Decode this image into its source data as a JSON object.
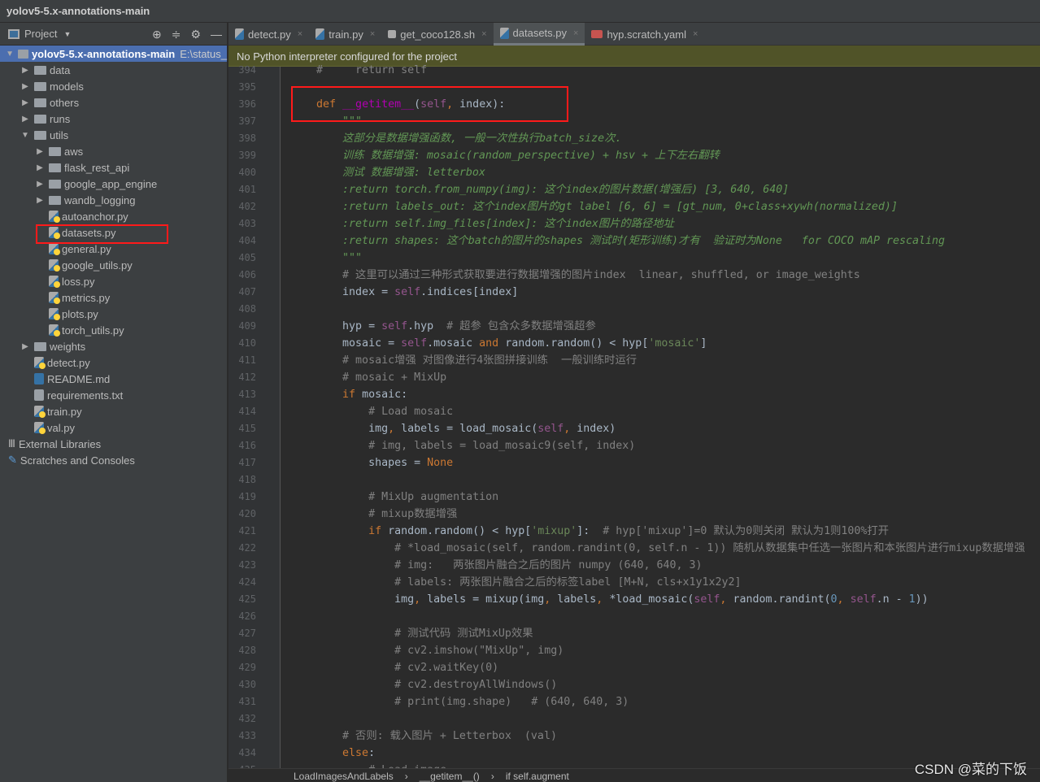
{
  "title": "yolov5-5.x-annotations-main",
  "sidebar": {
    "header": "Project",
    "header_chevron": "▼",
    "tools": [
      "⊕",
      "≑",
      "⚙",
      "—"
    ],
    "items": [
      {
        "label": "yolov5-5.x-annotations-main",
        "path": "E:\\status_",
        "type": "folder",
        "level": 0,
        "expanded": true,
        "selected": true
      },
      {
        "label": "data",
        "type": "folder",
        "level": 1
      },
      {
        "label": "models",
        "type": "folder",
        "level": 1
      },
      {
        "label": "others",
        "type": "folder",
        "level": 1
      },
      {
        "label": "runs",
        "type": "folder",
        "level": 1
      },
      {
        "label": "utils",
        "type": "folder",
        "level": 1,
        "expanded": true
      },
      {
        "label": "aws",
        "type": "folder",
        "level": 2
      },
      {
        "label": "flask_rest_api",
        "type": "folder",
        "level": 2
      },
      {
        "label": "google_app_engine",
        "type": "folder",
        "level": 2
      },
      {
        "label": "wandb_logging",
        "type": "folder",
        "level": 2
      },
      {
        "label": "autoanchor.py",
        "type": "py",
        "level": 2
      },
      {
        "label": "datasets.py",
        "type": "py",
        "level": 2,
        "highlighted": true
      },
      {
        "label": "general.py",
        "type": "py",
        "level": 2
      },
      {
        "label": "google_utils.py",
        "type": "py",
        "level": 2
      },
      {
        "label": "loss.py",
        "type": "py",
        "level": 2
      },
      {
        "label": "metrics.py",
        "type": "py",
        "level": 2
      },
      {
        "label": "plots.py",
        "type": "py",
        "level": 2
      },
      {
        "label": "torch_utils.py",
        "type": "py",
        "level": 2
      },
      {
        "label": "weights",
        "type": "folder",
        "level": 1
      },
      {
        "label": "detect.py",
        "type": "py",
        "level": 1
      },
      {
        "label": "README.md",
        "type": "md",
        "level": 1
      },
      {
        "label": "requirements.txt",
        "type": "txt",
        "level": 1
      },
      {
        "label": "train.py",
        "type": "py",
        "level": 1
      },
      {
        "label": "val.py",
        "type": "py",
        "level": 1
      },
      {
        "label": "External Libraries",
        "type": "lib",
        "level": 0
      },
      {
        "label": "Scratches and Consoles",
        "type": "scratch",
        "level": 0
      }
    ]
  },
  "tabs": [
    {
      "label": "detect.py",
      "icon": "python"
    },
    {
      "label": "train.py",
      "icon": "python"
    },
    {
      "label": "get_coco128.sh",
      "icon": "shell"
    },
    {
      "label": "datasets.py",
      "icon": "python",
      "active": true
    },
    {
      "label": "hyp.scratch.yaml",
      "icon": "yaml"
    }
  ],
  "tab_close": "×",
  "banner": "No Python interpreter configured for the project",
  "code": [
    {
      "n": "394",
      "t": [
        [
          "cm",
          "    #     return self"
        ]
      ]
    },
    {
      "n": "395",
      "t": []
    },
    {
      "n": "396",
      "t": [
        [
          "kw",
          "    def "
        ],
        [
          "fn",
          "__getitem__"
        ],
        [
          "plain",
          "("
        ],
        [
          "self",
          "self"
        ],
        [
          "kw",
          ", "
        ],
        [
          "plain",
          "index):"
        ]
      ]
    },
    {
      "n": "397",
      "t": [
        [
          "doc",
          "        \"\"\""
        ]
      ]
    },
    {
      "n": "398",
      "t": [
        [
          "doc",
          "        这部分是数据增强函数, 一般一次性执行batch_size次."
        ]
      ]
    },
    {
      "n": "399",
      "t": [
        [
          "doc",
          "        训练 数据增强: mosaic(random_perspective) + hsv + 上下左右翻转"
        ]
      ]
    },
    {
      "n": "400",
      "t": [
        [
          "doc",
          "        测试 数据增强: letterbox"
        ]
      ]
    },
    {
      "n": "401",
      "t": [
        [
          "doc",
          "        :return torch.from_numpy(img): 这个index的图片数据(增强后) [3, 640, 640]"
        ]
      ]
    },
    {
      "n": "402",
      "t": [
        [
          "doc",
          "        :return labels_out: 这个index图片的gt label [6, 6] = [gt_num, 0+class+xywh(normalized)]"
        ]
      ]
    },
    {
      "n": "403",
      "t": [
        [
          "doc",
          "        :return self.img_files[index]: 这个index图片的路径地址"
        ]
      ]
    },
    {
      "n": "404",
      "t": [
        [
          "doc",
          "        :return shapes: 这个batch的图片的shapes 测试时(矩形训练)才有  验证时为None   for COCO mAP rescaling"
        ]
      ]
    },
    {
      "n": "405",
      "t": [
        [
          "doc",
          "        \"\"\""
        ]
      ]
    },
    {
      "n": "406",
      "t": [
        [
          "cm",
          "        # 这里可以通过三种形式获取要进行数据增强的图片index  linear, shuffled, or image_weights"
        ]
      ]
    },
    {
      "n": "407",
      "t": [
        [
          "plain",
          "        index = "
        ],
        [
          "self",
          "self"
        ],
        [
          "plain",
          ".indices[index]"
        ]
      ]
    },
    {
      "n": "408",
      "t": []
    },
    {
      "n": "409",
      "t": [
        [
          "plain",
          "        hyp = "
        ],
        [
          "self",
          "self"
        ],
        [
          "plain",
          ".hyp  "
        ],
        [
          "cm",
          "# 超参 包含众多数据增强超参"
        ]
      ]
    },
    {
      "n": "410",
      "t": [
        [
          "plain",
          "        mosaic = "
        ],
        [
          "self",
          "self"
        ],
        [
          "plain",
          ".mosaic "
        ],
        [
          "kw",
          "and "
        ],
        [
          "plain",
          "random.random() < hyp["
        ],
        [
          "str",
          "'mosaic'"
        ],
        [
          "plain",
          "]"
        ]
      ]
    },
    {
      "n": "411",
      "t": [
        [
          "cm",
          "        # mosaic增强 对图像进行4张图拼接训练  一般训练时运行"
        ]
      ]
    },
    {
      "n": "412",
      "t": [
        [
          "cm",
          "        # mosaic + MixUp"
        ]
      ]
    },
    {
      "n": "413",
      "t": [
        [
          "kw",
          "        if "
        ],
        [
          "plain",
          "mosaic:"
        ]
      ]
    },
    {
      "n": "414",
      "t": [
        [
          "cm",
          "            # Load mosaic"
        ]
      ]
    },
    {
      "n": "415",
      "t": [
        [
          "plain",
          "            img"
        ],
        [
          "kw",
          ", "
        ],
        [
          "plain",
          "labels = load_mosaic("
        ],
        [
          "self",
          "self"
        ],
        [
          "kw",
          ", "
        ],
        [
          "plain",
          "index)"
        ]
      ]
    },
    {
      "n": "416",
      "t": [
        [
          "cm",
          "            # img, labels = load_mosaic9(self, index)"
        ]
      ]
    },
    {
      "n": "417",
      "t": [
        [
          "plain",
          "            shapes = "
        ],
        [
          "kw",
          "None"
        ]
      ]
    },
    {
      "n": "418",
      "t": []
    },
    {
      "n": "419",
      "t": [
        [
          "cm",
          "            # MixUp augmentation"
        ]
      ]
    },
    {
      "n": "420",
      "t": [
        [
          "cm",
          "            # mixup数据增强"
        ]
      ]
    },
    {
      "n": "421",
      "t": [
        [
          "kw",
          "            if "
        ],
        [
          "plain",
          "random.random() < hyp["
        ],
        [
          "str",
          "'mixup'"
        ],
        [
          "plain",
          "]:  "
        ],
        [
          "cm",
          "# hyp['mixup']=0 默认为0则关闭 默认为1则100%打开"
        ]
      ]
    },
    {
      "n": "422",
      "t": [
        [
          "cm",
          "                # *load_mosaic(self, random.randint(0, self.n - 1)) 随机从数据集中任选一张图片和本张图片进行mixup数据增强"
        ]
      ]
    },
    {
      "n": "423",
      "t": [
        [
          "cm",
          "                # img:   两张图片融合之后的图片 numpy (640, 640, 3)"
        ]
      ]
    },
    {
      "n": "424",
      "t": [
        [
          "cm",
          "                # labels: 两张图片融合之后的标签label [M+N, cls+x1y1x2y2]"
        ]
      ]
    },
    {
      "n": "425",
      "t": [
        [
          "plain",
          "                img"
        ],
        [
          "kw",
          ", "
        ],
        [
          "plain",
          "labels = mixup(img"
        ],
        [
          "kw",
          ", "
        ],
        [
          "plain",
          "labels"
        ],
        [
          "kw",
          ", "
        ],
        [
          "plain",
          "*load_mosaic("
        ],
        [
          "self",
          "self"
        ],
        [
          "kw",
          ", "
        ],
        [
          "plain",
          "random.randint("
        ],
        [
          "num",
          "0"
        ],
        [
          "kw",
          ", "
        ],
        [
          "self",
          "self"
        ],
        [
          "plain",
          ".n - "
        ],
        [
          "num",
          "1"
        ],
        [
          "plain",
          "))"
        ]
      ]
    },
    {
      "n": "426",
      "t": []
    },
    {
      "n": "427",
      "t": [
        [
          "cm",
          "                # 测试代码 测试MixUp效果"
        ]
      ]
    },
    {
      "n": "428",
      "t": [
        [
          "cm",
          "                # cv2.imshow(\"MixUp\", img)"
        ]
      ]
    },
    {
      "n": "429",
      "t": [
        [
          "cm",
          "                # cv2.waitKey(0)"
        ]
      ]
    },
    {
      "n": "430",
      "t": [
        [
          "cm",
          "                # cv2.destroyAllWindows()"
        ]
      ]
    },
    {
      "n": "431",
      "t": [
        [
          "cm",
          "                # print(img.shape)   # (640, 640, 3)"
        ]
      ]
    },
    {
      "n": "432",
      "t": []
    },
    {
      "n": "433",
      "t": [
        [
          "cm",
          "        # 否则: 载入图片 + Letterbox  (val)"
        ]
      ]
    },
    {
      "n": "434",
      "t": [
        [
          "kw",
          "        else"
        ],
        [
          "plain",
          ":"
        ]
      ]
    },
    {
      "n": "435",
      "t": [
        [
          "cm",
          "            # Load image"
        ]
      ]
    }
  ],
  "breadcrumb": [
    "LoadImagesAndLabels",
    "__getitem__()",
    "if self.augment"
  ],
  "breadcrumb_sep": "›",
  "watermark": "CSDN @菜的下饭",
  "colors": {
    "keyword": "#cc7832",
    "docstring": "#629755",
    "comment": "#808080",
    "string": "#6a8759",
    "self": "#94558d",
    "highlight_box": "#ff1a1a",
    "banner": "#505328"
  }
}
